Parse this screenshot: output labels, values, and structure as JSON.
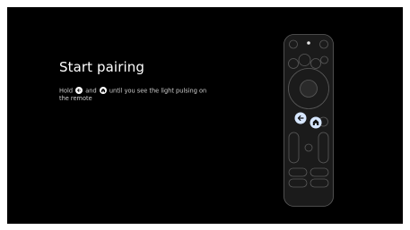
{
  "pairing": {
    "title": "Start pairing",
    "instruction_part1": "Hold",
    "instruction_part2": "and",
    "instruction_part3": "until you see the light pulsing on the remote",
    "back_icon": "back-arrow-icon",
    "home_icon": "home-icon"
  },
  "colors": {
    "background": "#000000",
    "remote_body": "#1b1b1b",
    "remote_outline": "#5e5e5e",
    "highlight_button": "#d6e6ff"
  }
}
